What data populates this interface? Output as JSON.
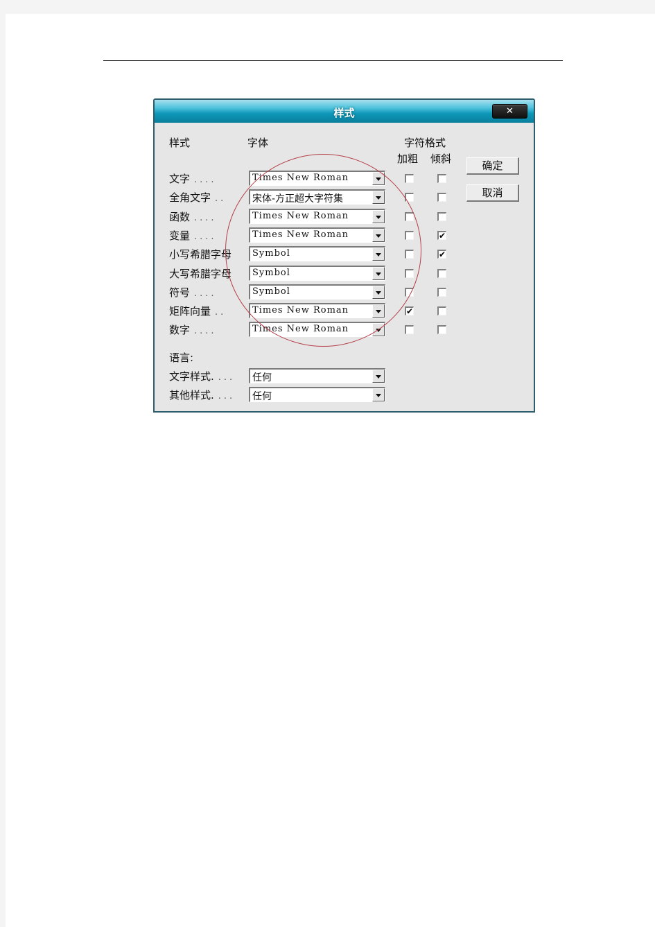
{
  "dialog": {
    "title": "样式",
    "close_label": "✕",
    "headers": {
      "style": "样式",
      "font": "字体",
      "char_format": "字符格式",
      "bold": "加粗",
      "italic": "倾斜"
    },
    "rows": [
      {
        "label": "文字",
        "dots": "....",
        "font": "Times New Roman",
        "bold": false,
        "italic": false
      },
      {
        "label": "全角文字",
        "dots": "..",
        "font": "宋体-方正超大字符集",
        "bold": false,
        "italic": false
      },
      {
        "label": "函数",
        "dots": "....",
        "font": "Times New Roman",
        "bold": false,
        "italic": false
      },
      {
        "label": "变量",
        "dots": "....",
        "font": "Times New Roman",
        "bold": false,
        "italic": true
      },
      {
        "label": "小写希腊字母",
        "dots": "",
        "font": "Symbol",
        "bold": false,
        "italic": true
      },
      {
        "label": "大写希腊字母",
        "dots": "",
        "font": "Symbol",
        "bold": false,
        "italic": false
      },
      {
        "label": "符号",
        "dots": "....",
        "font": "Symbol",
        "bold": false,
        "italic": false
      },
      {
        "label": "矩阵向量",
        "dots": "..",
        "font": "Times New Roman",
        "bold": true,
        "italic": false
      },
      {
        "label": "数字",
        "dots": "....",
        "font": "Times New Roman",
        "bold": false,
        "italic": false
      }
    ],
    "language": {
      "label": "语言:",
      "rows": [
        {
          "label": "文字样式.",
          "dots": "...",
          "value": "任何"
        },
        {
          "label": "其他样式.",
          "dots": "...",
          "value": "任何"
        }
      ]
    },
    "buttons": {
      "ok": "确定",
      "cancel": "取消"
    },
    "check_mark": "✔",
    "annotation_color": "#b4404a",
    "titlebar_color": "#0d97b8"
  }
}
